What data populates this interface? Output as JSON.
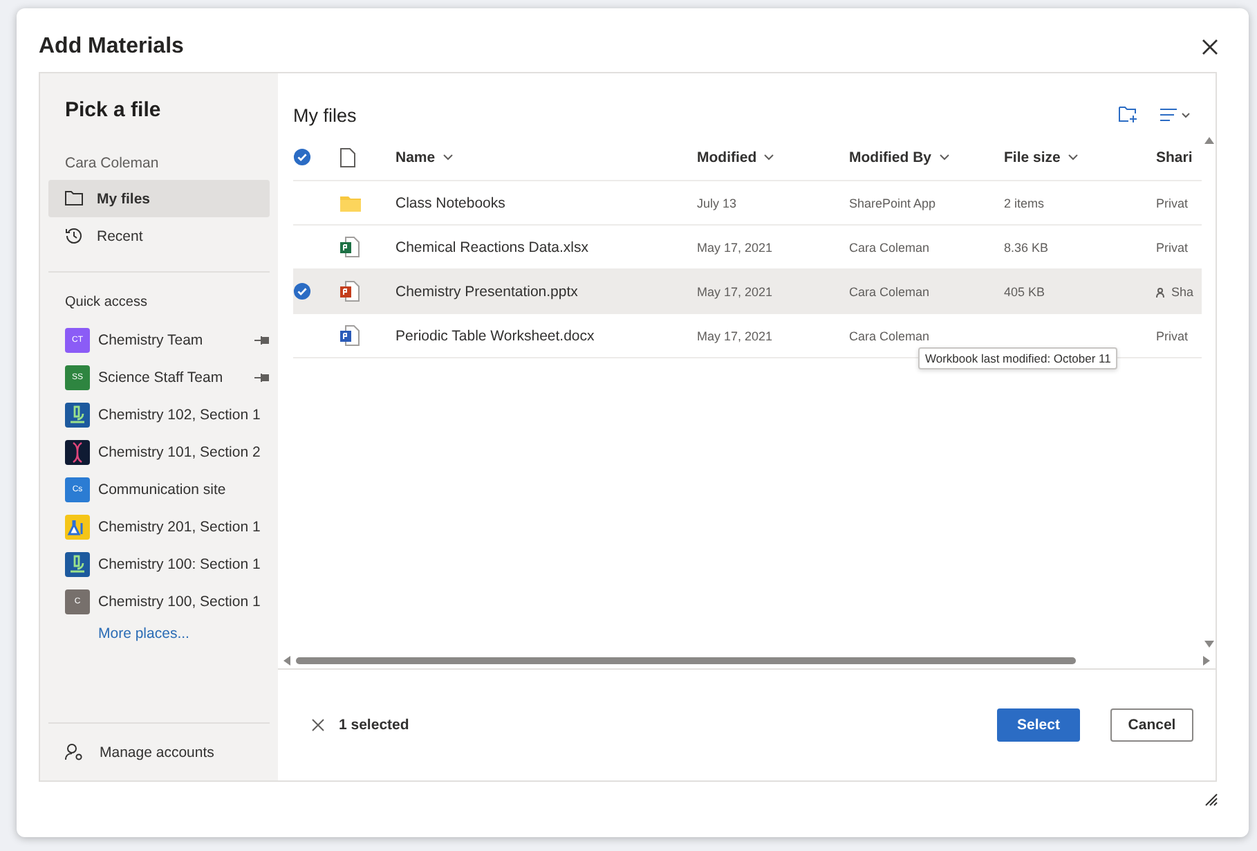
{
  "dialog": {
    "title": "Add Materials"
  },
  "sidebar": {
    "title": "Pick a file",
    "account": "Cara Coleman",
    "nav": [
      {
        "label": "My files",
        "kind": "folder",
        "selected": true
      },
      {
        "label": "Recent",
        "kind": "history",
        "selected": false
      }
    ],
    "quick_access_title": "Quick access",
    "quick_access": [
      {
        "label": "Chemistry Team",
        "badge": "CT",
        "color": "#8b5cf6",
        "pinned": true
      },
      {
        "label": "Science Staff Team",
        "badge": "SS",
        "color": "#2e8540",
        "pinned": true
      },
      {
        "label": "Chemistry 102, Section 1",
        "kind": "microscope",
        "color": "#1d5a9e",
        "pinned": false
      },
      {
        "label": "Chemistry 101, Section 2",
        "kind": "dna",
        "color": "#0f1b33",
        "pinned": false
      },
      {
        "label": "Communication site",
        "badge": "Cs",
        "color": "#2b7cd3",
        "pinned": false
      },
      {
        "label": "Chemistry 201, Section 1",
        "kind": "flask",
        "color": "#f5c518",
        "pinned": false
      },
      {
        "label": "Chemistry 100: Section 1",
        "kind": "microscope",
        "color": "#1d5a9e",
        "pinned": false
      },
      {
        "label": "Chemistry 100, Section 1",
        "badge": "C",
        "color": "#77706c",
        "pinned": false
      }
    ],
    "more_link": "More places...",
    "manage": "Manage accounts"
  },
  "main": {
    "title": "My files",
    "columns": [
      "Name",
      "Modified",
      "Modified By",
      "File size",
      "Shari"
    ],
    "all_checked": true,
    "rows": [
      {
        "kind": "folder",
        "name": "Class Notebooks",
        "modified": "July 13",
        "modified_by": "SharePoint App",
        "size": "2 items",
        "sharing": "Privat",
        "selected": false
      },
      {
        "kind": "excel",
        "name": "Chemical Reactions Data.xlsx",
        "modified": "May 17, 2021",
        "modified_by": "Cara Coleman",
        "size": "8.36 KB",
        "sharing": "Privat",
        "selected": false
      },
      {
        "kind": "powerpoint",
        "name": "Chemistry Presentation.pptx",
        "modified": "May 17, 2021",
        "modified_by": "Cara Coleman",
        "size": "405 KB",
        "sharing": "Sha",
        "shared": true,
        "selected": true
      },
      {
        "kind": "word",
        "name": "Periodic Table Worksheet.docx",
        "modified": "May 17, 2021",
        "modified_by": "Cara Coleman",
        "sharing": "Privat",
        "selected": false
      }
    ],
    "tooltip": "Workbook last modified: October 11"
  },
  "footer": {
    "selection": "1 selected",
    "buttons": [
      "Select",
      "Cancel"
    ]
  }
}
